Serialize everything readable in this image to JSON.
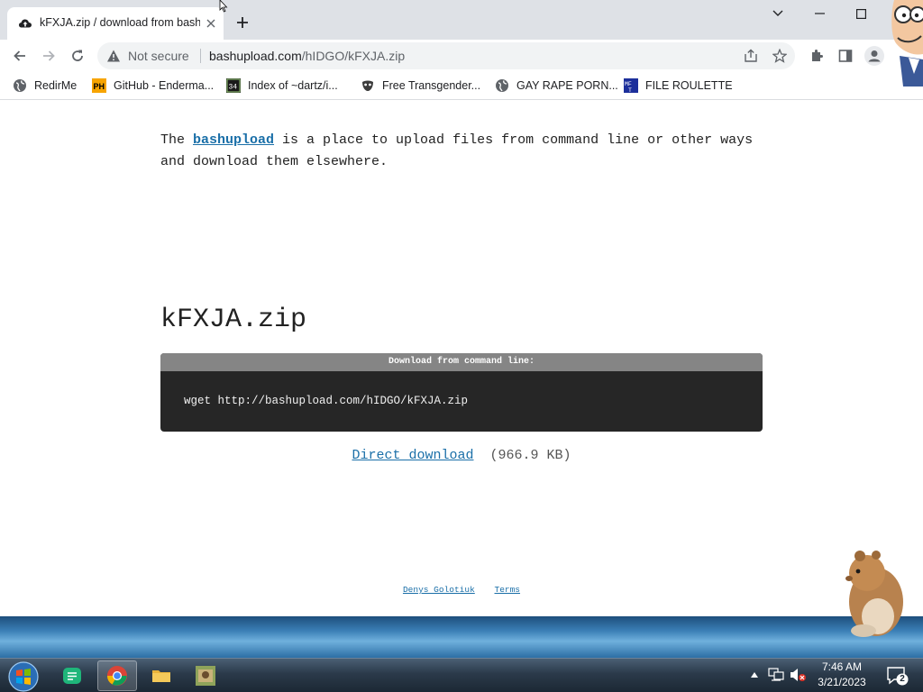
{
  "browser": {
    "tab_title": "kFXJA.zip / download from bashupload",
    "security_label": "Not secure",
    "url_host": "bashupload.com",
    "url_path": "/hIDGO/kFXJA.zip"
  },
  "bookmarks": [
    {
      "label": "RedirMe",
      "icon": "globe-icon"
    },
    {
      "label": "GitHub - Enderma...",
      "icon": "ph-icon"
    },
    {
      "label": "Index of ~dartz/i...",
      "icon": "index-icon"
    },
    {
      "label": "Free Transgender...",
      "icon": "mask-icon"
    },
    {
      "label": "GAY RAPE PORN...",
      "icon": "globe-icon"
    },
    {
      "label": "FILE ROULETTE",
      "icon": "mf-icon"
    }
  ],
  "page": {
    "intro_before": "The ",
    "intro_link": "bashupload",
    "intro_after": " is a place to upload files from command line or other ways and download them elsewhere.",
    "filename": "kFXJA.zip",
    "cmd_header": "Download from command line:",
    "cmd_line": "wget http://bashupload.com/hIDGO/kFXJA.zip",
    "download_link": "Direct download",
    "download_size": "(966.9 KB)",
    "footer_author": "Denys Golotiuk",
    "footer_terms": "Terms"
  },
  "taskbar": {
    "clock_time": "7:46 AM",
    "clock_date": "3/21/2023",
    "notification_count": "2"
  },
  "colors": {
    "tabstrip": "#dee1e6",
    "link": "#1a6fa8",
    "command_box": "#262626",
    "command_header": "#858585"
  }
}
